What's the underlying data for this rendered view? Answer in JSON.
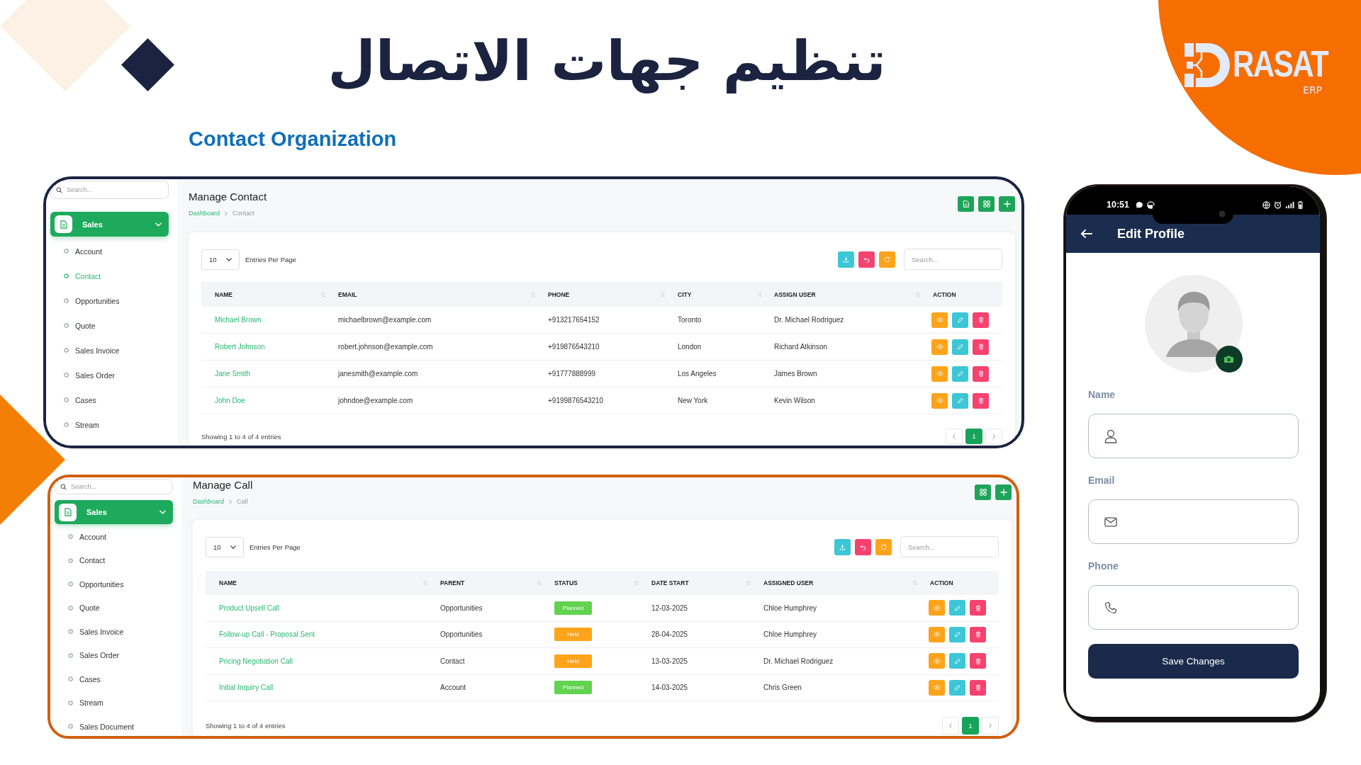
{
  "title": "تنظيم جهات الاتصال",
  "subtitle": "Contact Organization",
  "logo": {
    "wordmark": "RASAT",
    "tagline": "ERP"
  },
  "contact_screen": {
    "sidebar": {
      "search": {
        "placeholder": "Search..."
      },
      "group": {
        "label": "Sales",
        "expanded": true
      },
      "items": [
        {
          "label": "Account",
          "selected": false
        },
        {
          "label": "Contact",
          "selected": true
        },
        {
          "label": "Opportunities",
          "selected": false
        },
        {
          "label": "Quote",
          "selected": false
        },
        {
          "label": "Sales Invoice",
          "selected": false
        },
        {
          "label": "Sales Order",
          "selected": false
        },
        {
          "label": "Cases",
          "selected": false
        },
        {
          "label": "Stream",
          "selected": false
        }
      ]
    },
    "heading": "Manage Contact",
    "breadcrumb": [
      {
        "label": "Dashboard",
        "kind": "link"
      },
      {
        "label": "Contact",
        "kind": "current"
      }
    ],
    "page_size": "10",
    "page_size_label": "Entries Per Page",
    "search": {
      "placeholder": "Search..."
    },
    "table": {
      "columns": [
        {
          "label": "NAME",
          "kind": "link",
          "sortable": true
        },
        {
          "label": "EMAIL",
          "kind": "text",
          "sortable": true
        },
        {
          "label": "PHONE",
          "kind": "text",
          "sortable": true
        },
        {
          "label": "CITY",
          "kind": "text",
          "sortable": true
        },
        {
          "label": "ASSIGN USER",
          "kind": "text",
          "sortable": true
        },
        {
          "label": "ACTION",
          "kind": "actions",
          "sortable": false
        }
      ],
      "rows": [
        {
          "cells": [
            "Michael Brown",
            "michaelbrown@example.com",
            "+913217654152",
            "Toronto",
            "Dr. Michael Rodriguez"
          ]
        },
        {
          "cells": [
            "Robert Johnson",
            "robert.johnson@example.com",
            "+919876543210",
            "London",
            "Richard Atkinson"
          ]
        },
        {
          "cells": [
            "Jane Smith",
            "janesmith@example.com",
            "+91777888999",
            "Los Angeles",
            "James Brown"
          ]
        },
        {
          "cells": [
            "John Doe",
            "johndoe@example.com",
            "+9199876543210",
            "New York",
            "Kevin Wilson"
          ]
        }
      ]
    },
    "summary": "Showing 1 to 4 of 4 entries",
    "pages": [
      {
        "label": "1",
        "selected": true
      }
    ]
  },
  "call_screen": {
    "sidebar": {
      "search": {
        "placeholder": "Search..."
      },
      "group": {
        "label": "Sales",
        "expanded": true
      },
      "items": [
        {
          "label": "Account",
          "selected": false
        },
        {
          "label": "Contact",
          "selected": false
        },
        {
          "label": "Opportunities",
          "selected": false
        },
        {
          "label": "Quote",
          "selected": false
        },
        {
          "label": "Sales Invoice",
          "selected": false
        },
        {
          "label": "Sales Order",
          "selected": false
        },
        {
          "label": "Cases",
          "selected": false
        },
        {
          "label": "Stream",
          "selected": false
        },
        {
          "label": "Sales Document",
          "selected": false
        }
      ]
    },
    "heading": "Manage Call",
    "breadcrumb": [
      {
        "label": "Dashboard",
        "kind": "link"
      },
      {
        "label": "Call",
        "kind": "current"
      }
    ],
    "page_size": "10",
    "page_size_label": "Entries Per Page",
    "search": {
      "placeholder": "Search..."
    },
    "table": {
      "columns": [
        {
          "label": "NAME",
          "kind": "link",
          "sortable": true
        },
        {
          "label": "PARENT",
          "kind": "text",
          "sortable": true
        },
        {
          "label": "STATUS",
          "kind": "badge",
          "sortable": true
        },
        {
          "label": "DATE START",
          "kind": "text",
          "sortable": true
        },
        {
          "label": "ASSIGNED USER",
          "kind": "text",
          "sortable": true
        },
        {
          "label": "ACTION",
          "kind": "actions",
          "sortable": false
        }
      ],
      "rows": [
        {
          "cells": [
            "Product Upsell Call",
            "Opportunities",
            {
              "label": "Planned",
              "color": "#62d34f"
            },
            "12-03-2025",
            "Chloe Humphrey"
          ]
        },
        {
          "cells": [
            "Follow-up Call - Proposal Sent",
            "Opportunities",
            {
              "label": "Held",
              "color": "#ffa41b"
            },
            "28-04-2025",
            "Chloe Humphrey"
          ]
        },
        {
          "cells": [
            "Pricing Negotiation Call",
            "Contact",
            {
              "label": "Held",
              "color": "#ffa41b"
            },
            "13-03-2025",
            "Dr. Michael Rodriguez"
          ]
        },
        {
          "cells": [
            "Initial Inquiry Call",
            "Account",
            {
              "label": "Planned",
              "color": "#62d34f"
            },
            "14-03-2025",
            "Chris Green"
          ]
        }
      ]
    },
    "summary": "Showing 1 to 4 of 4 entries",
    "pages": [
      {
        "label": "1",
        "selected": true
      }
    ]
  },
  "phone": {
    "time": "10:51",
    "title": "Edit Profile",
    "fields": [
      {
        "label": "Name",
        "kind": "name"
      },
      {
        "label": "Email",
        "kind": "email"
      },
      {
        "label": "Phone",
        "kind": "phone"
      }
    ],
    "save_button": "Save Changes"
  }
}
